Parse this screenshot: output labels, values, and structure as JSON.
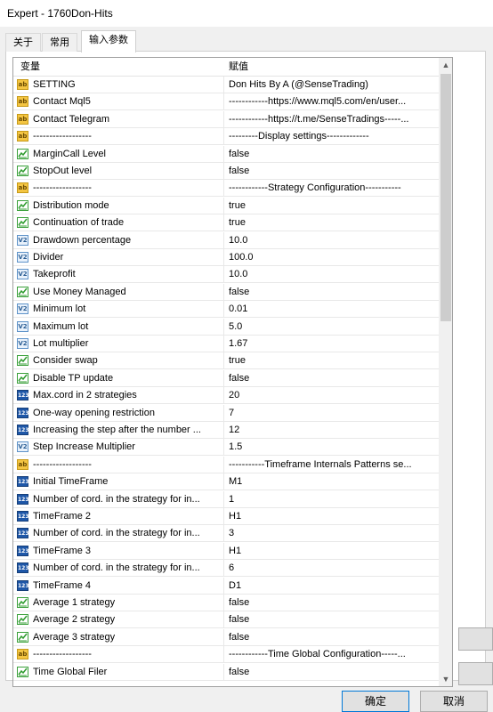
{
  "window": {
    "title": "Expert - 1760Don-Hits"
  },
  "tabs": [
    {
      "label": "关于"
    },
    {
      "label": "常用"
    },
    {
      "label": "输入参数"
    }
  ],
  "table": {
    "headers": {
      "variable": "变量",
      "value": "赋值"
    },
    "rows": [
      {
        "type": "ab",
        "name": "SETTING",
        "value": "Don Hits By A (@SenseTrading)"
      },
      {
        "type": "ab",
        "name": "Contact Mql5",
        "value": "------------https://www.mql5.com/en/user..."
      },
      {
        "type": "ab",
        "name": "Contact Telegram",
        "value": "------------https://t.me/SenseTradings-----..."
      },
      {
        "type": "ab",
        "name": "------------------",
        "value": "---------Display settings-------------"
      },
      {
        "type": "bool",
        "name": "MarginCall Level",
        "value": "false"
      },
      {
        "type": "bool",
        "name": "StopOut level",
        "value": "false"
      },
      {
        "type": "ab",
        "name": "------------------",
        "value": "------------Strategy Configuration-----------"
      },
      {
        "type": "bool",
        "name": "Distribution mode",
        "value": "true"
      },
      {
        "type": "bool",
        "name": "Continuation of trade",
        "value": "true"
      },
      {
        "type": "v2",
        "name": "Drawdown percentage",
        "value": "10.0"
      },
      {
        "type": "v2",
        "name": "Divider",
        "value": "100.0"
      },
      {
        "type": "v2",
        "name": "Takeprofit",
        "value": "10.0"
      },
      {
        "type": "bool",
        "name": "Use Money Managed",
        "value": "false"
      },
      {
        "type": "v2",
        "name": "Minimum lot",
        "value": "0.01"
      },
      {
        "type": "v2",
        "name": "Maximum lot",
        "value": "5.0"
      },
      {
        "type": "v2",
        "name": "Lot multiplier",
        "value": "1.67"
      },
      {
        "type": "bool",
        "name": "Consider swap",
        "value": "true"
      },
      {
        "type": "bool",
        "name": "Disable TP update",
        "value": "false"
      },
      {
        "type": "123",
        "name": "Max.cord in 2 strategies",
        "value": "20"
      },
      {
        "type": "123",
        "name": "One-way opening restriction",
        "value": "7"
      },
      {
        "type": "123",
        "name": "Increasing the step after the number ...",
        "value": "12"
      },
      {
        "type": "v2",
        "name": "Step Increase Multiplier",
        "value": "1.5"
      },
      {
        "type": "ab",
        "name": "------------------",
        "value": "-----------Timeframe Internals Patterns se..."
      },
      {
        "type": "123",
        "name": "Initial TimeFrame",
        "value": "M1"
      },
      {
        "type": "123",
        "name": "Number of cord. in the strategy for in...",
        "value": "1"
      },
      {
        "type": "123",
        "name": "TimeFrame 2",
        "value": "H1"
      },
      {
        "type": "123",
        "name": "Number of cord. in the strategy for in...",
        "value": "3"
      },
      {
        "type": "123",
        "name": "TimeFrame 3",
        "value": "H1"
      },
      {
        "type": "123",
        "name": "Number of cord. in the strategy for in...",
        "value": "6"
      },
      {
        "type": "123",
        "name": "TimeFrame 4",
        "value": "D1"
      },
      {
        "type": "bool",
        "name": "Average 1 strategy",
        "value": "false"
      },
      {
        "type": "bool",
        "name": "Average 2 strategy",
        "value": "false"
      },
      {
        "type": "bool",
        "name": "Average 3 strategy",
        "value": "false"
      },
      {
        "type": "ab",
        "name": "------------------",
        "value": "------------Time Global Configuration-----..."
      },
      {
        "type": "bool",
        "name": "Time Global Filer",
        "value": "false"
      }
    ]
  },
  "icons": {
    "ab": "ab",
    "v2": "V2",
    "123": "123"
  },
  "buttons": {
    "ok": "确定",
    "cancel": "取消"
  }
}
